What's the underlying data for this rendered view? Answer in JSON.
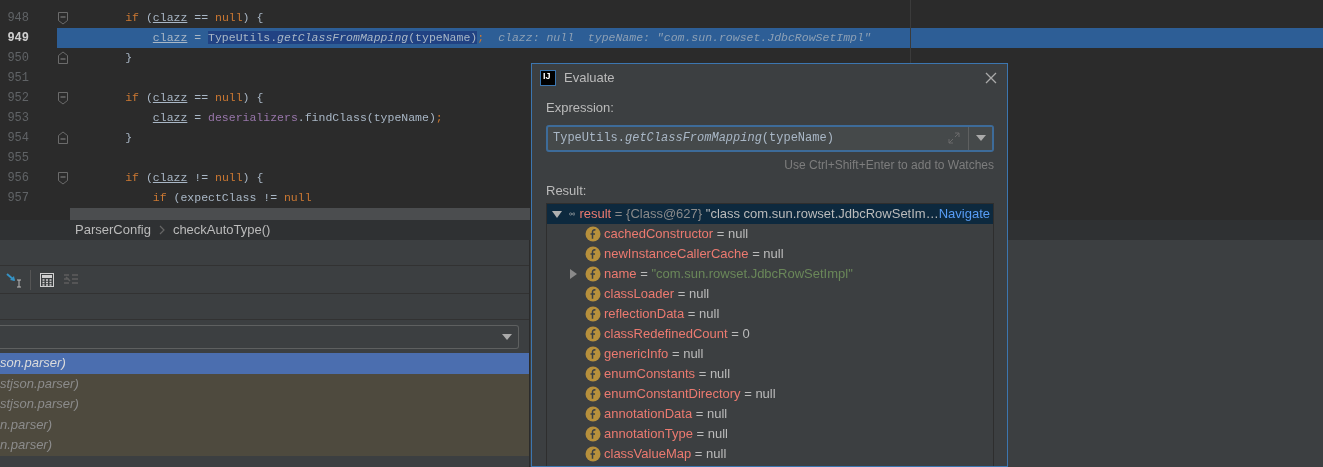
{
  "editor": {
    "lines": [
      {
        "number": "948",
        "kind": "block_start",
        "current": false,
        "tokens": [
          {
            "kind": "keyword",
            "text": "        if",
            "highlighted": false
          },
          {
            "kind": "plain",
            "text": " (",
            "highlighted": false
          },
          {
            "kind": "local",
            "text": "clazz",
            "highlighted": false
          },
          {
            "kind": "plain",
            "text": " == ",
            "highlighted": false
          },
          {
            "kind": "keyword",
            "text": "null",
            "highlighted": false
          },
          {
            "kind": "plain",
            "text": ") {",
            "highlighted": false
          }
        ]
      },
      {
        "number": "949",
        "kind": "plain",
        "current": true,
        "tokens": [
          {
            "kind": "local",
            "text": "            clazz",
            "highlighted": false
          },
          {
            "kind": "plain",
            "text": " = ",
            "highlighted": false
          },
          {
            "kind": "plain",
            "text": "TypeUtils.",
            "highlighted": true
          },
          {
            "kind": "static_call",
            "text": "getClassFromMapping",
            "highlighted": true
          },
          {
            "kind": "plain",
            "text": "(typeName)",
            "highlighted": true
          },
          {
            "kind": "punct",
            "text": ";",
            "highlighted": false
          }
        ],
        "inline_values": "clazz: null  typeName: \"com.sun.rowset.JdbcRowSetImpl\""
      },
      {
        "number": "950",
        "kind": "block_end",
        "current": false,
        "tokens": [
          {
            "kind": "plain",
            "text": "        }",
            "highlighted": false
          }
        ]
      },
      {
        "number": "951",
        "kind": "plain",
        "current": false
      },
      {
        "number": "952",
        "kind": "block_start",
        "current": false,
        "tokens": [
          {
            "kind": "keyword",
            "text": "        if",
            "highlighted": false
          },
          {
            "kind": "plain",
            "text": " (",
            "highlighted": false
          },
          {
            "kind": "local",
            "text": "clazz",
            "highlighted": false
          },
          {
            "kind": "plain",
            "text": " == ",
            "highlighted": false
          },
          {
            "kind": "keyword",
            "text": "null",
            "highlighted": false
          },
          {
            "kind": "plain",
            "text": ") {",
            "highlighted": false
          }
        ]
      },
      {
        "number": "953",
        "kind": "plain",
        "current": false,
        "tokens": [
          {
            "kind": "local",
            "text": "            clazz",
            "highlighted": false
          },
          {
            "kind": "plain",
            "text": " = ",
            "highlighted": false
          },
          {
            "kind": "field",
            "text": "deserializers",
            "highlighted": false
          },
          {
            "kind": "plain",
            "text": ".findClass(typeName)",
            "highlighted": false
          },
          {
            "kind": "punct",
            "text": ";",
            "highlighted": false
          }
        ]
      },
      {
        "number": "954",
        "kind": "block_end",
        "current": false,
        "tokens": [
          {
            "kind": "plain",
            "text": "        }",
            "highlighted": false
          }
        ]
      },
      {
        "number": "955",
        "kind": "plain",
        "current": false
      },
      {
        "number": "956",
        "kind": "block_start",
        "current": false,
        "tokens": [
          {
            "kind": "keyword",
            "text": "        if",
            "highlighted": false
          },
          {
            "kind": "plain",
            "text": " (",
            "highlighted": false
          },
          {
            "kind": "local",
            "text": "clazz",
            "highlighted": false
          },
          {
            "kind": "plain",
            "text": " != ",
            "highlighted": false
          },
          {
            "kind": "keyword",
            "text": "null",
            "highlighted": false
          },
          {
            "kind": "plain",
            "text": ") {",
            "highlighted": false
          }
        ]
      },
      {
        "number": "957",
        "kind": "plain",
        "current": false,
        "tokens": [
          {
            "kind": "keyword",
            "text": "            if",
            "highlighted": false
          },
          {
            "kind": "plain",
            "text": " (expectClass != ",
            "highlighted": false
          },
          {
            "kind": "keyword",
            "text": "null",
            "highlighted": false
          }
        ]
      }
    ]
  },
  "breadcrumb": [
    "ParserConfig",
    "checkAutoType()"
  ],
  "frames": [
    {
      "text": "son.parser)",
      "selected": true
    },
    {
      "text": "stjson.parser)",
      "selected": false
    },
    {
      "text": "stjson.parser)",
      "selected": false
    },
    {
      "text": "n.parser)",
      "selected": false
    },
    {
      "text": "n.parser)",
      "selected": false
    }
  ],
  "dialog": {
    "logo_text": "IJ",
    "title": "Evaluate",
    "expression_label": "Expression:",
    "expression": "TypeUtils.*getClassFromMapping*(typeName)",
    "hint": "Use Ctrl+Shift+Enter to add to Watches",
    "result_label": "Result:",
    "result": {
      "name": "result",
      "ref": "= {Class@627}",
      "value": "\"class com.sun.rowset.JdbcRowSetIm…",
      "link": "Navigate",
      "expanded": true,
      "selected": true
    },
    "fields": [
      {
        "name": "cachedConstructor",
        "value": "= null",
        "kind": "plain"
      },
      {
        "name": "newInstanceCallerCache",
        "value": "= null",
        "kind": "plain"
      },
      {
        "name": "name",
        "value": "= \"com.sun.rowset.JdbcRowSetImpl\"",
        "kind": "string",
        "expanded": false
      },
      {
        "name": "classLoader",
        "value": "= null",
        "kind": "plain"
      },
      {
        "name": "reflectionData",
        "value": "= null",
        "kind": "plain"
      },
      {
        "name": "classRedefinedCount",
        "value": "= 0",
        "kind": "plain"
      },
      {
        "name": "genericInfo",
        "value": "= null",
        "kind": "plain"
      },
      {
        "name": "enumConstants",
        "value": "= null",
        "kind": "plain"
      },
      {
        "name": "enumConstantDirectory",
        "value": "= null",
        "kind": "plain"
      },
      {
        "name": "annotationData",
        "value": "= null",
        "kind": "plain"
      },
      {
        "name": "annotationType",
        "value": "= null",
        "kind": "plain"
      },
      {
        "name": "classValueMap",
        "value": "= null",
        "kind": "plain"
      }
    ]
  }
}
